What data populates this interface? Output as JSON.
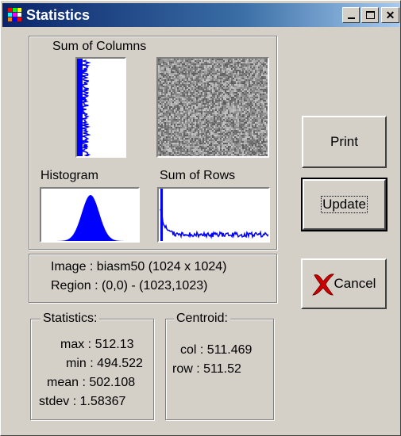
{
  "window": {
    "title": "Statistics"
  },
  "plots": {
    "sum_columns_label": "Sum of Columns",
    "histogram_label": "Histogram",
    "sum_rows_label": "Sum of Rows"
  },
  "info": {
    "image_line": "Image : biasm50 (1024 x 1024)",
    "region_line": "Region : (0,0) - (1023,1023)"
  },
  "statistics": {
    "title": "Statistics:",
    "max": "max : 512.13",
    "min": "min : 494.522",
    "mean": "mean : 502.108",
    "stdev": "stdev : 1.58367"
  },
  "centroid": {
    "title": "Centroid:",
    "col": "col : 511.469",
    "row": "row : 511.52"
  },
  "buttons": {
    "print": "Print",
    "update": "Update",
    "cancel": "Cancel"
  },
  "colors": {
    "plot_line": "#0000ff",
    "title_start": "#0a246a",
    "title_end": "#a6caf0"
  }
}
